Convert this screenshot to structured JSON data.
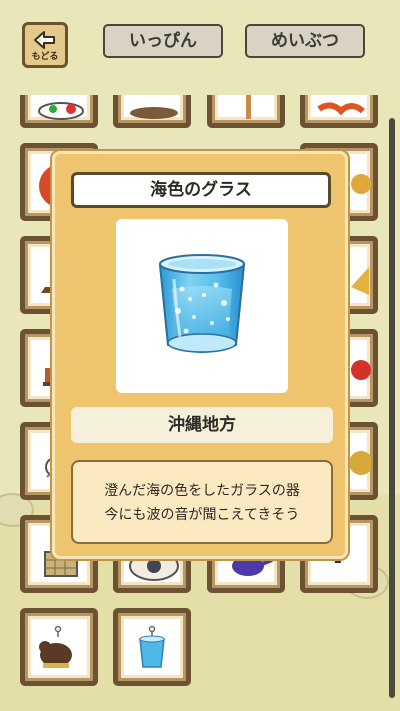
{
  "header": {
    "back_label": "もどる",
    "tabs": [
      {
        "label": "いっぴん"
      },
      {
        "label": "めいぶつ"
      }
    ]
  },
  "grid": {
    "unknown_mark": "?"
  },
  "popup": {
    "item_name": "海色のグラス",
    "region": "沖縄地方",
    "description_line1": "澄んだ海の色をしたガラスの器",
    "description_line2": "今にも波の音が聞こえてきそう"
  },
  "colors": {
    "background": "#e9e6b9",
    "popup": "#eec46f",
    "tile_frame": "#6b5232",
    "glass": "#4fb8e6"
  }
}
